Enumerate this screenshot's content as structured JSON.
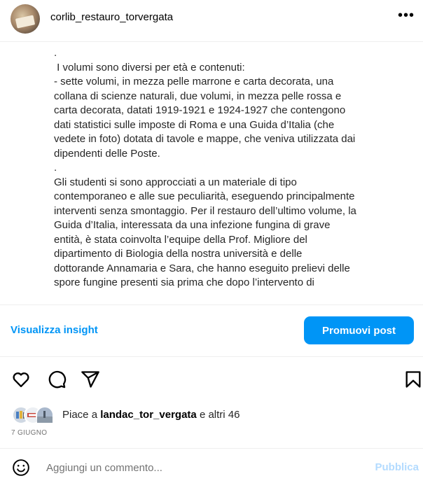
{
  "post": {
    "username": "corlib_restauro_torvergata",
    "more_label": "•••"
  },
  "caption": {
    "text": ".\n I volumi sono diversi per età e contenuti:\n- sette volumi, in mezza pelle marrone e carta decorata, una\ncollana di scienze naturali, due volumi, in mezza pelle rossa e\ncarta decorata, datati 1919-1921 e 1924-1927 che contengono\ndati statistici sulle imposte di Roma e una Guida d’Italia (che\nvedete in foto) dotata di tavole e mappe, che veniva utilizzata dai\ndipendenti delle Poste.\n.\nGli studenti si sono approcciati a un materiale di tipo\ncontemporaneo e alle sue peculiarità, eseguendo principalmente\ninterventi senza smontaggio. Per il restauro dell’ultimo volume, la\nGuida d’Italia, interessata da una infezione fungina di grave\nentità, è stata coinvolta l’equipe della Prof. Migliore del\ndipartimento di Biologia della nostra università e delle\ndottorande Annamaria e Sara, che hanno eseguito prelievi delle\nspore fungine presenti sia prima che dopo l’intervento di"
  },
  "actions_bar": {
    "insights_label": "Visualizza insight",
    "promote_label": "Promuovi post"
  },
  "likes": {
    "prefix": "Piace a ",
    "user": "landac_tor_vergata",
    "suffix": " e altri 46"
  },
  "date": "7 GIUGNO",
  "comment": {
    "placeholder": "Aggiungi un commento...",
    "publish_label": "Pubblica"
  },
  "colors": {
    "accent": "#0095f6",
    "muted": "#737373",
    "publish_disabled": "#b3dbff"
  }
}
